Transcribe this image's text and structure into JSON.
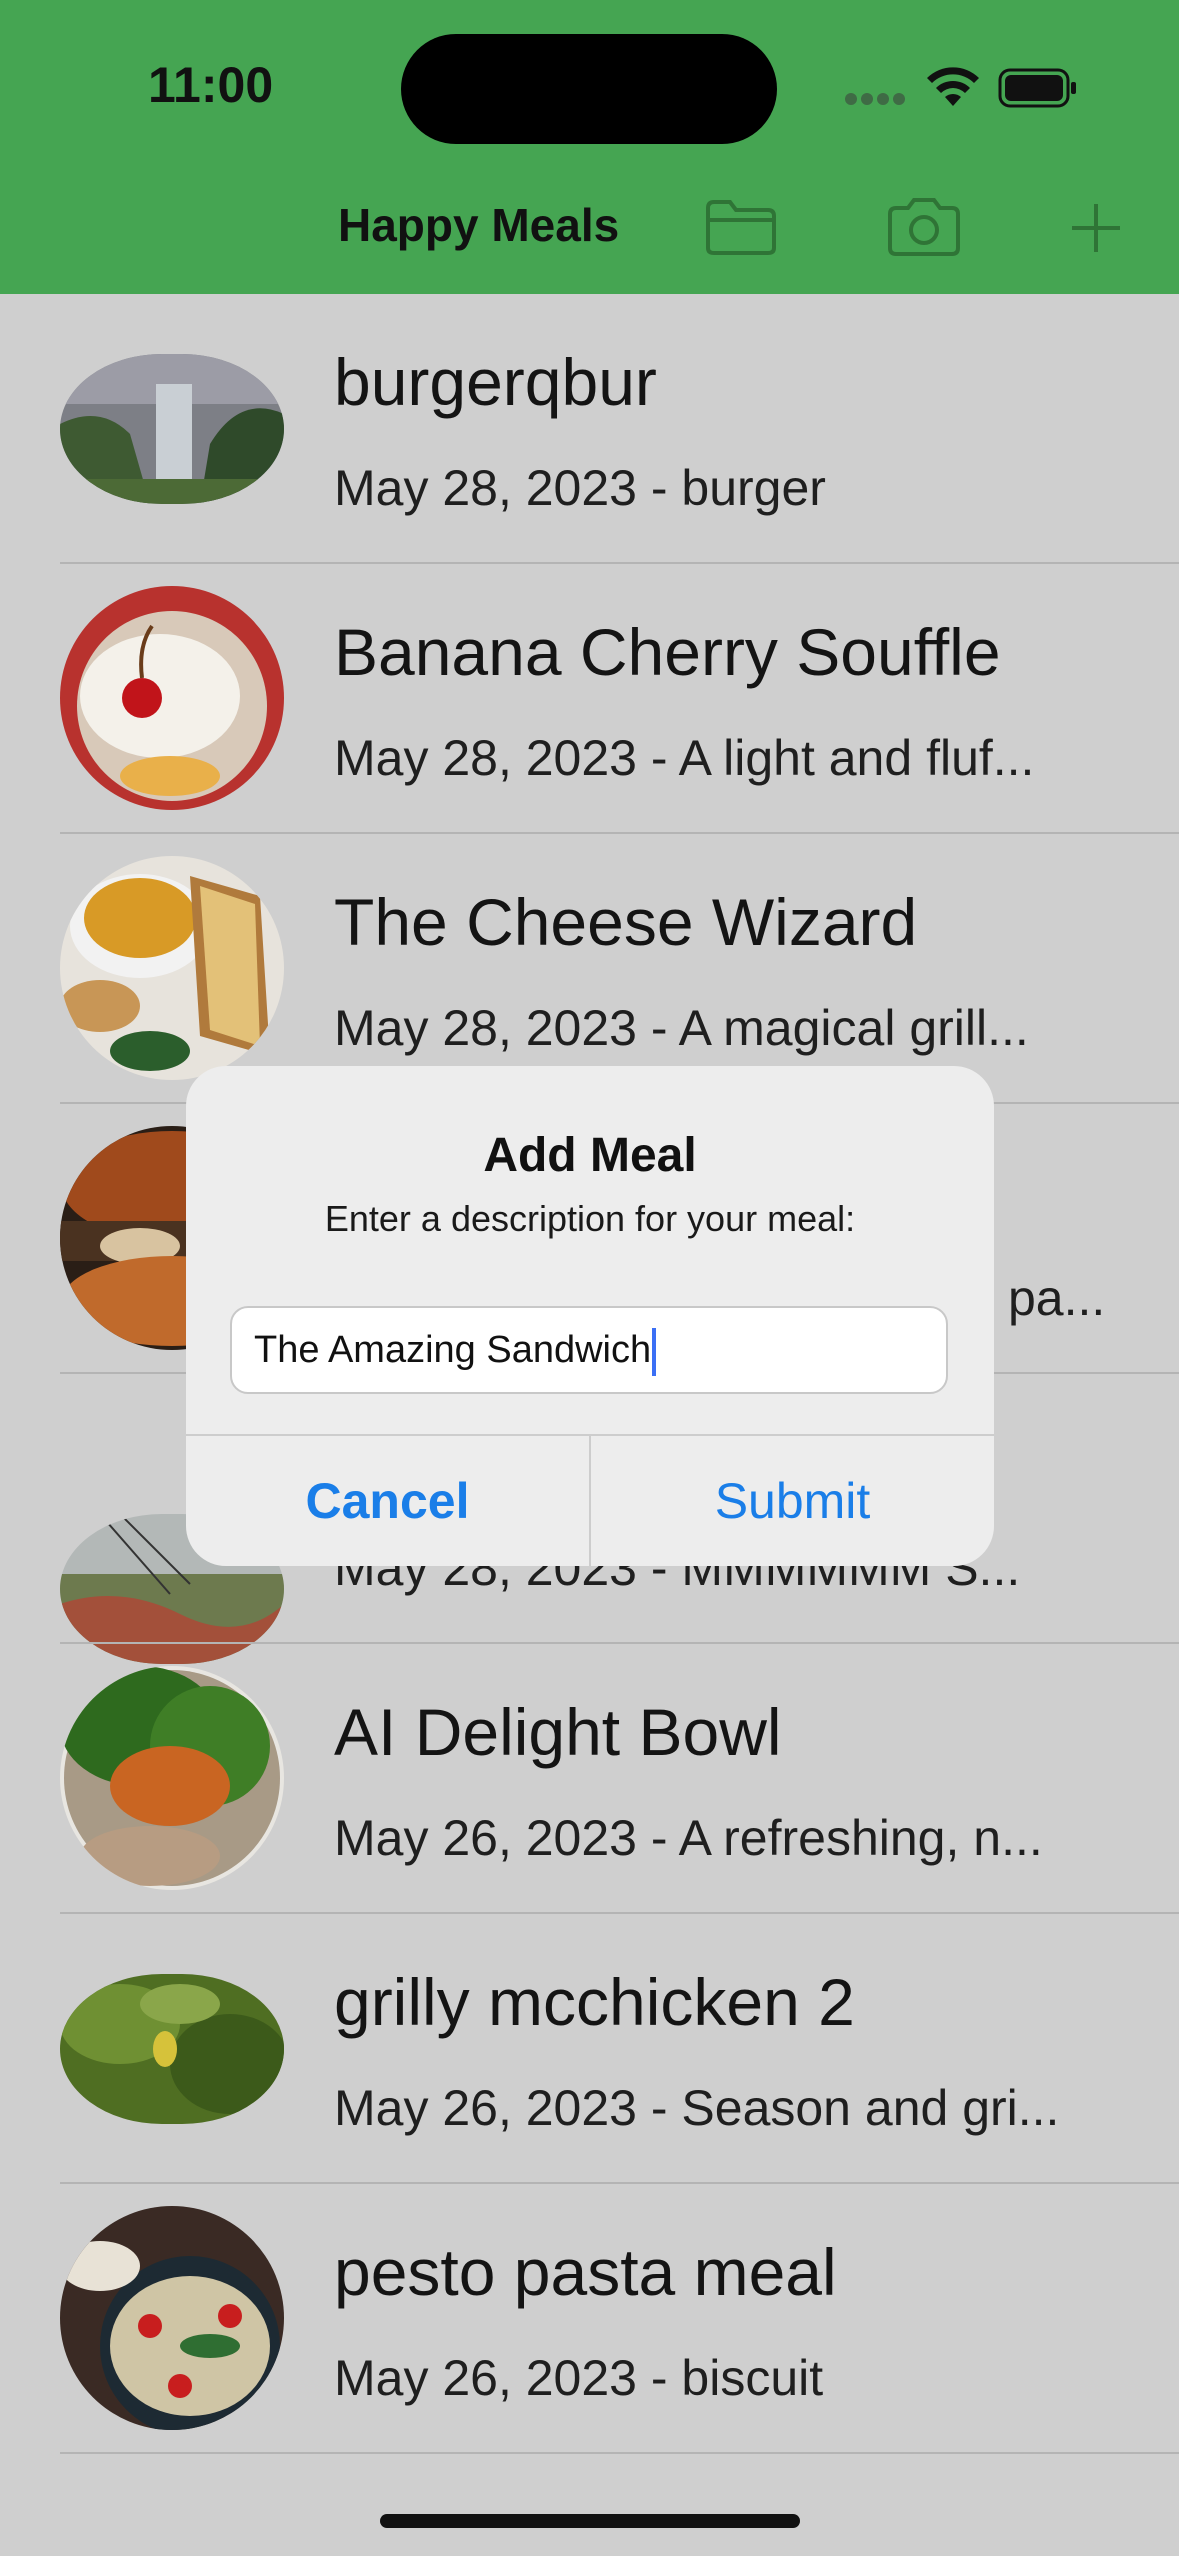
{
  "status_bar": {
    "time": "11:00"
  },
  "nav": {
    "title": "Happy Meals",
    "icons": [
      "folder-icon",
      "camera-icon",
      "plus-icon"
    ]
  },
  "meals": [
    {
      "title": "burgerqbur",
      "subtitle": "May 28, 2023 - burger"
    },
    {
      "title": "Banana Cherry Souffle",
      "subtitle": "May 28, 2023 - A light and fluf..."
    },
    {
      "title": "The Cheese Wizard",
      "subtitle": "May 28, 2023 - A magical grill..."
    },
    {
      "title": "",
      "subtitle": "pa..."
    },
    {
      "title": "",
      "subtitle": "May 28, 2023 - MMMMMM S..."
    },
    {
      "title": "AI Delight Bowl",
      "subtitle": "May 26, 2023 - A refreshing, n..."
    },
    {
      "title": "grilly mcchicken 2",
      "subtitle": "May 26, 2023 - Season and gri..."
    },
    {
      "title": "pesto pasta meal",
      "subtitle": "May 26, 2023 - biscuit"
    }
  ],
  "alert": {
    "title": "Add Meal",
    "message": "Enter a description for your meal:",
    "input_value": "The Amazing Sandwich",
    "cancel_label": "Cancel",
    "submit_label": "Submit"
  },
  "colors": {
    "nav_green": "#45a552",
    "accent_blue": "#1a7ee8",
    "dimmed_background": "#cfcfcf"
  }
}
